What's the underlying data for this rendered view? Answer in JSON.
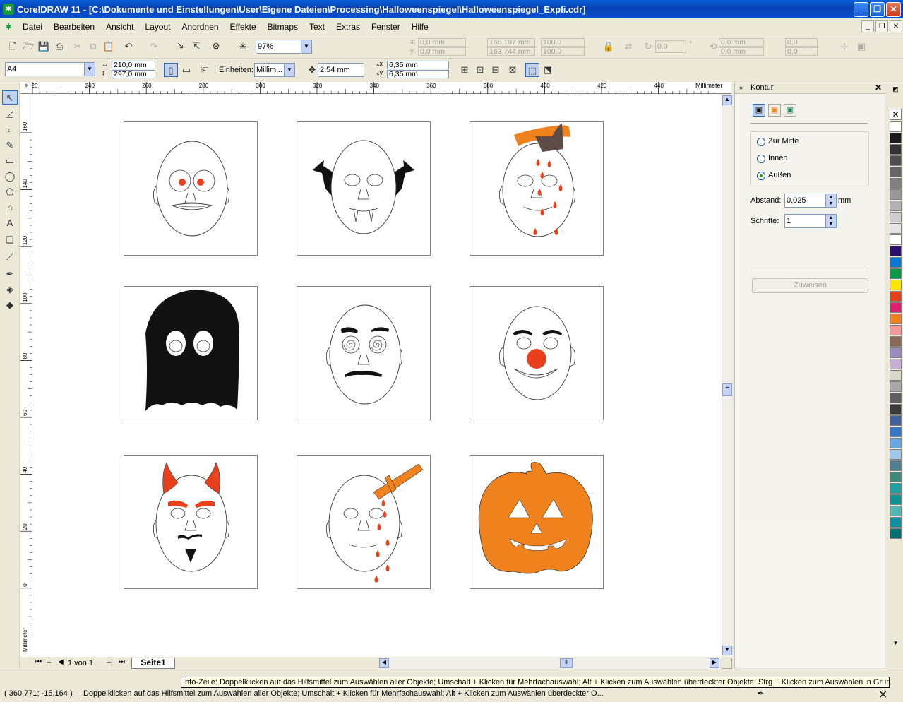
{
  "window": {
    "title": "CorelDRAW 11 - [C:\\Dokumente und Einstellungen\\User\\Eigene Dateien\\Processing\\Halloweenspiegel\\Halloweenspiegel_Expli.cdr]",
    "controls": [
      "_",
      "❐",
      "✕"
    ]
  },
  "menu": [
    "Datei",
    "Bearbeiten",
    "Ansicht",
    "Layout",
    "Anordnen",
    "Effekte",
    "Bitmaps",
    "Text",
    "Extras",
    "Fenster",
    "Hilfe"
  ],
  "toolbar": {
    "zoom": "97%",
    "x_pos": "0,0 mm",
    "y_pos": "0,0 mm",
    "width": "168,197 mm",
    "height": "163,744 mm",
    "scale_x": "100,0",
    "scale_y": "100,0",
    "angle": "0,0",
    "pos2_x": "0,0 mm",
    "pos2_y": "0,0 mm",
    "val_a": "0,0",
    "val_b": "0,0"
  },
  "propbar": {
    "paper": "A4",
    "page_w": "210,0 mm",
    "page_h": "297,0 mm",
    "units_label": "Einheiten:",
    "units": "Millim...",
    "nudge": "2,54 mm",
    "dup_x": "6,35 mm",
    "dup_y": "6,35 mm"
  },
  "ruler": {
    "top_ticks": [
      "220",
      "240",
      "260",
      "280",
      "300",
      "320",
      "340",
      "360",
      "380",
      "400",
      "420",
      "440"
    ],
    "top_unit": "Millimeter",
    "left_ticks": [
      "160",
      "140",
      "120",
      "100",
      "80",
      "60",
      "40",
      "20",
      "0"
    ],
    "left_unit": "Millimeter"
  },
  "pages": {
    "counter": "1 von 1",
    "tab": "Seite1"
  },
  "docker": {
    "title": "Kontur",
    "options": [
      "Zur Mitte",
      "Innen",
      "Außen"
    ],
    "selected": "Außen",
    "distance_label": "Abstand:",
    "distance_value": "0,025",
    "distance_unit": "mm",
    "steps_label": "Schritte:",
    "steps_value": "1",
    "apply_label": "Zuweisen"
  },
  "masks": [
    "scared",
    "vampire",
    "axe",
    "ghost",
    "hypnotized",
    "clown",
    "devil",
    "knife",
    "pumpkin"
  ],
  "palette": [
    "#ffffff",
    "#1a1a1a",
    "#333333",
    "#4d4d4d",
    "#666666",
    "#808080",
    "#999999",
    "#b3b3b3",
    "#cccccc",
    "#e6e6e6",
    "#ffffff",
    "#2b0f6b",
    "#0a78d4",
    "#0a9a4a",
    "#ffe600",
    "#e8401c",
    "#e0206e",
    "#f0821e",
    "#f29a9a",
    "#8a6a56",
    "#9a8ac0",
    "#c8b0d4",
    "#d8d8c8",
    "#a8a8a8",
    "#606060",
    "#3a3a3a",
    "#4060a0",
    "#3878c8",
    "#68a8e0",
    "#a0c8e8",
    "#508090",
    "#408878",
    "#20a0a0",
    "#109090",
    "#50b8b0",
    "#1090a0",
    "#007070"
  ],
  "status": {
    "coords": "( 360,771; -15,164 )",
    "hint": "Doppelklicken auf das Hilfsmittel zum Auswählen aller Objekte; Umschalt + Klicken für Mehrfachauswahl; Alt + Klicken zum Auswählen überdeckter O...",
    "tooltip": "Info-Zeile: Doppelklicken auf das Hilfsmittel zum Auswählen aller Objekte; Umschalt + Klicken für Mehrfachauswahl; Alt + Klicken zum Auswählen überdeckter Objekte; Strg + Klicken zum Auswählen in Gruppen"
  },
  "colors": {
    "accent_orange": "#f0821e",
    "blood_red": "#e8401c",
    "ghost_black": "#111111"
  }
}
